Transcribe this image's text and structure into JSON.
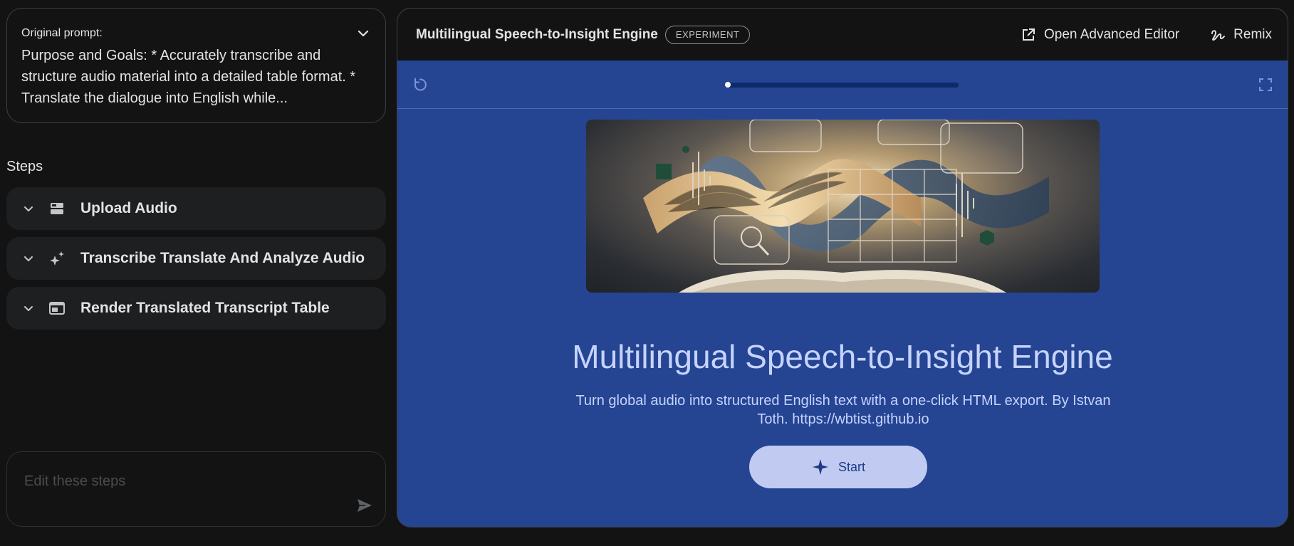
{
  "prompt": {
    "label": "Original prompt:",
    "text": "Purpose and Goals: * Accurately transcribe and structure audio material into a detailed table format. * Translate the dialogue into English while..."
  },
  "steps": {
    "title": "Steps",
    "items": [
      {
        "label": "Upload Audio",
        "icon": "upload-audio-icon"
      },
      {
        "label": "Transcribe Translate And Analyze Audio",
        "icon": "sparkle-icon"
      },
      {
        "label": "Render Translated Transcript Table",
        "icon": "table-window-icon"
      }
    ]
  },
  "edit": {
    "placeholder": "Edit these steps"
  },
  "app": {
    "title": "Multilingual Speech-to-Insight Engine",
    "badge": "EXPERIMENT",
    "actions": {
      "open_editor": "Open Advanced Editor",
      "remix": "Remix"
    },
    "progress": 0
  },
  "content": {
    "title": "Multilingual Speech-to-Insight Engine",
    "subtitle": "Turn global audio into structured English text with a one-click HTML export. By Istvan Toth. https://wbtist.github.io",
    "start_label": "Start"
  },
  "colors": {
    "canvas": "#254592",
    "title_text": "#c6d3ff",
    "button_bg": "#c1cbf2",
    "button_text": "#1c3a86"
  }
}
